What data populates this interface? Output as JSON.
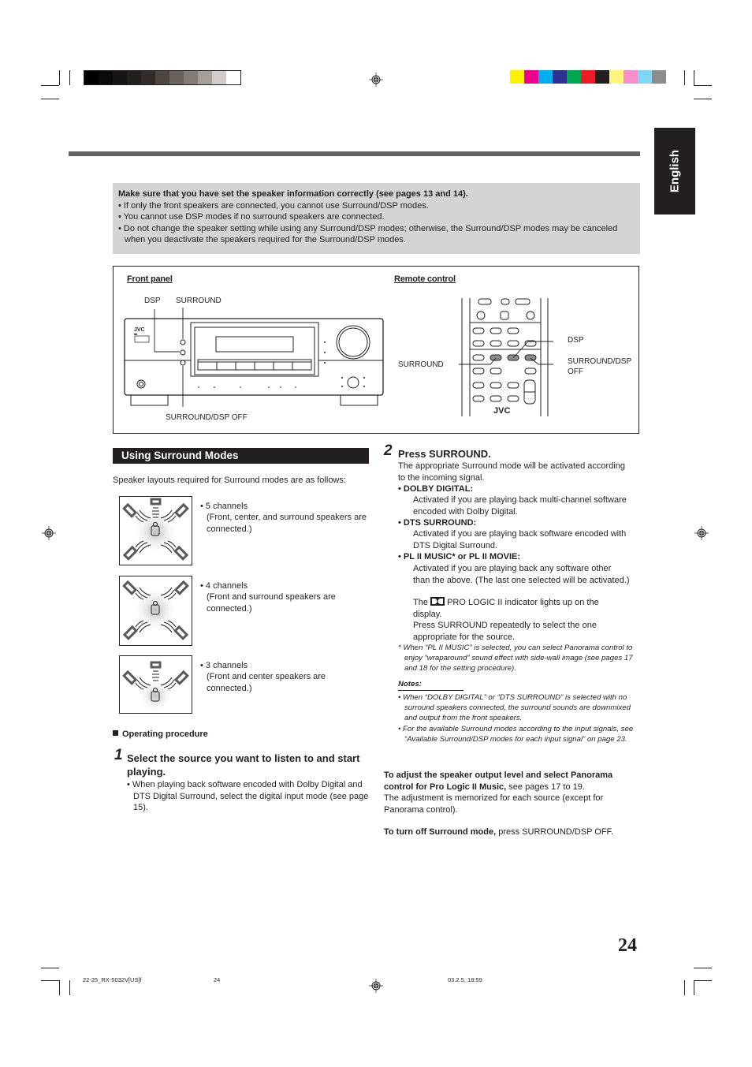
{
  "print_marks": {
    "gray_scale": [
      "#000000",
      "#0b0909",
      "#171413",
      "#231f1d",
      "#332b29",
      "#4d4542",
      "#6a615e",
      "#847b78",
      "#a69e9b",
      "#d2cbc9",
      "#ffffff"
    ],
    "color_scale": [
      "#fff200",
      "#ec008c",
      "#00aeef",
      "#2e3192",
      "#00a651",
      "#ed1c24",
      "#231f20",
      "#fff57f",
      "#f68fc8",
      "#7fd6f7",
      "#8c8c8c"
    ]
  },
  "language_tab": "English",
  "caution": {
    "heading": "Make sure that you have set the speaker information correctly (see pages 13 and 14).",
    "items": [
      "• If only the front speakers are connected, you cannot use Surround/DSP modes.",
      "• You cannot use DSP modes if no surround speakers are connected.",
      "• Do not change the speaker setting while using any Surround/DSP modes; otherwise, the Surround/DSP modes may be canceled when you deactivate the speakers required for the Surround/DSP modes."
    ]
  },
  "diagram": {
    "front_panel": {
      "title": "Front panel",
      "labels": {
        "dsp": "DSP",
        "surround": "SURROUND",
        "off": "SURROUND/DSP OFF"
      },
      "brand": "JVC"
    },
    "remote_control": {
      "title": "Remote control",
      "labels": {
        "surround": "SURROUND",
        "dsp": "DSP",
        "off_line1": "SURROUND/DSP",
        "off_line2": "OFF"
      },
      "brand": "JVC"
    }
  },
  "section": {
    "title": "Using Surround Modes",
    "intro": "Speaker layouts required for Surround modes are as follows:",
    "layouts": [
      {
        "icon": "5-channel-speaker-layout-icon",
        "title": "• 5 channels",
        "desc": "(Front, center, and surround speakers are connected.)"
      },
      {
        "icon": "4-channel-speaker-layout-icon",
        "title": "• 4 channels",
        "desc": "(Front and surround speakers are connected.)"
      },
      {
        "icon": "3-channel-speaker-layout-icon",
        "title": "• 3 channels",
        "desc": "(Front and center speakers are connected.)"
      }
    ],
    "procedure_label": "Operating procedure",
    "step1": {
      "num": "1",
      "title": "Select the source you want to listen to and start playing.",
      "bullet": "• When playing back software encoded with Dolby Digital and DTS Digital Surround, select the digital input mode (see page 15)."
    },
    "step2": {
      "num": "2",
      "title": "Press SURROUND.",
      "intro": "The appropriate Surround mode will be activated according to the incoming signal.",
      "modes": [
        {
          "name": "• DOLBY DIGITAL:",
          "desc": "Activated if you are playing back multi-channel software encoded with Dolby Digital."
        },
        {
          "name": "• DTS SURROUND:",
          "desc": "Activated if you are playing back software encoded with DTS Digital Surround."
        },
        {
          "name": "• PL II MUSIC* or PL II MOVIE:",
          "desc": "Activated if you are playing back any software other than the above. (The last one selected will be activated.)"
        }
      ],
      "indicator_pre": "The",
      "indicator_post": "PRO LOGIC II indicator lights up on the display.",
      "repeat": "Press SURROUND repeatedly to select the one appropriate for the source.",
      "footnote": "* When “PL II MUSIC” is selected, you can select Panorama control to enjoy “wraparound” sound effect with side-wall image (see pages 17 and 18 for the setting procedure)."
    },
    "notes": {
      "title": "Notes:",
      "items": [
        "• When “DOLBY DIGITAL” or “DTS SURROUND” is selected with no surround speakers connected, the surround sounds are downmixed and output from the front speakers.",
        "• For the available Surround modes according to the input signals, see “Available Surround/DSP modes for each input signal” on page 23."
      ]
    },
    "adjust": {
      "bold": "To adjust the speaker output level and select Panorama control for Pro Logic II Music,",
      "rest": " see pages 17 to 19.",
      "line2": "The adjustment is memorized for each source (except for Panorama control)."
    },
    "turn_off": {
      "bold": "To turn off Surround mode,",
      "rest": " press SURROUND/DSP OFF."
    }
  },
  "page_number": "24",
  "footer": {
    "file": "22-25_RX-5032V[US]f",
    "page": "24",
    "timestamp": "03.2.5, 18:59"
  }
}
